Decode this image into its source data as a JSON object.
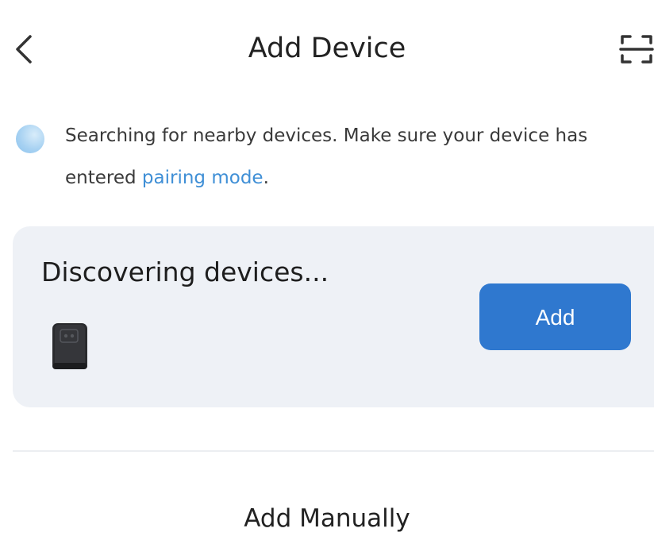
{
  "header": {
    "title": "Add Device",
    "back_icon": "chevron-left-icon",
    "scan_icon": "scan-icon"
  },
  "notice": {
    "text_before_link": "Searching for nearby devices. Make sure your device has entered ",
    "link_text": "pairing mode",
    "text_after_link": ".",
    "link_color": "#3f8fd6"
  },
  "discovery_card": {
    "title": "Discovering devices...",
    "device_icon": "smart-plug-device-icon",
    "add_label": "Add",
    "button_color": "#2f78cf",
    "background_color": "#eef1f6"
  },
  "footer": {
    "add_manually_label": "Add Manually"
  }
}
